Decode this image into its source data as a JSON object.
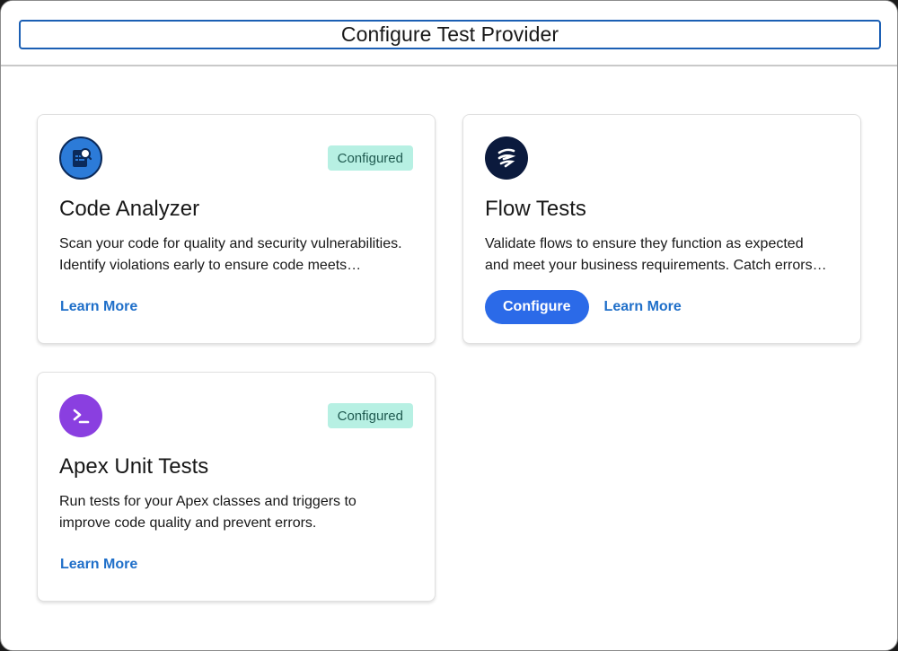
{
  "header": {
    "title": "Configure Test Provider"
  },
  "providers": [
    {
      "name": "Code Analyzer",
      "icon": "code-scan-icon",
      "badge": "Configured",
      "description_lines": [
        "Scan your code for quality and security vulnerabilities.",
        "Identify violations early to ensure code meets…"
      ],
      "learn_more": "Learn More"
    },
    {
      "name": "Flow Tests",
      "icon": "flow-icon",
      "description_lines": [
        "Validate flows to ensure they function as expected",
        "and meet your business requirements. Catch errors…"
      ],
      "configure": "Configure",
      "learn_more": "Learn More"
    },
    {
      "name": "Apex Unit Tests",
      "icon": "terminal-icon",
      "badge": "Configured",
      "description_lines": [
        "Run tests for your Apex classes and triggers to",
        "improve code quality and prevent errors."
      ],
      "learn_more": "Learn More"
    }
  ],
  "colors": {
    "accent": "#2b6ae8",
    "link": "#1f6fc9",
    "badge_bg": "#b7f0e3",
    "badge_text": "#1f5a50",
    "code_analyzer_icon_bg": "#2c7bd8",
    "flow_icon_bg": "#0b1a3d",
    "apex_icon_bg": "#8a3fe0",
    "title_border": "#1b5fb4"
  }
}
